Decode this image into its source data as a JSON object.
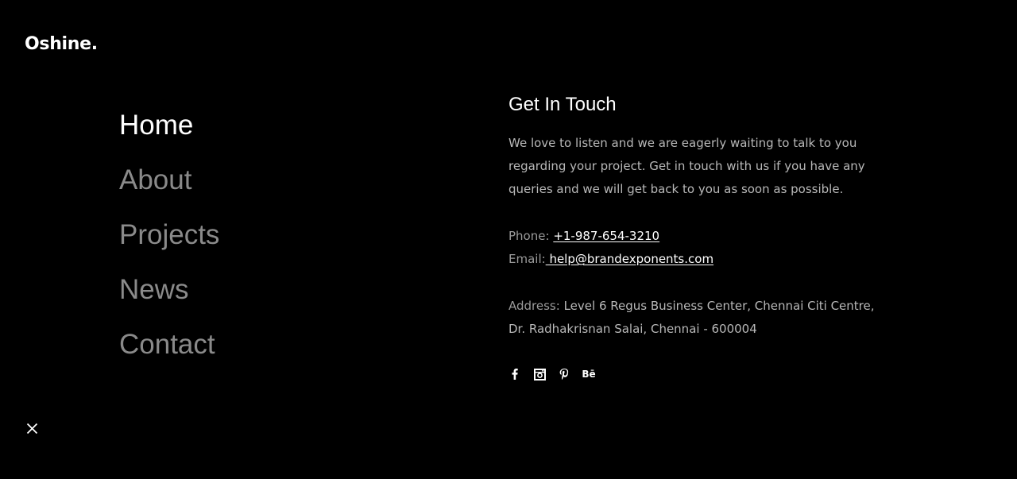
{
  "brand": {
    "logo_text": "Oshine."
  },
  "nav": {
    "items": [
      {
        "label": "Home"
      },
      {
        "label": "About"
      },
      {
        "label": "Projects"
      },
      {
        "label": "News"
      },
      {
        "label": "Contact"
      }
    ],
    "active_index": 0
  },
  "contact": {
    "heading": "Get In Touch",
    "intro": "We love to listen and we are eagerly waiting to talk to you regarding your project. Get in touch with us if you have any queries and we will get back to you as soon as possible.",
    "phone_label": "Phone:",
    "phone_value": "+1-987-654-3210",
    "email_label": "Email:",
    "email_value": " help@brandexponents.com",
    "address_label": "Address:",
    "address_value": "Level 6 Regus Business Center, Chennai Citi Centre, Dr. Radhakrisnan Salai, Chennai - 600004"
  },
  "social": {
    "icons": [
      "facebook-icon",
      "instagram-icon",
      "pinterest-icon",
      "behance-icon"
    ],
    "behance_text": "Bē"
  },
  "colors": {
    "background": "#000000",
    "text_primary": "#ffffff",
    "text_muted": "#8a8a8a",
    "body_text": "#b8b8b8"
  },
  "close": {
    "icon": "close-icon"
  }
}
